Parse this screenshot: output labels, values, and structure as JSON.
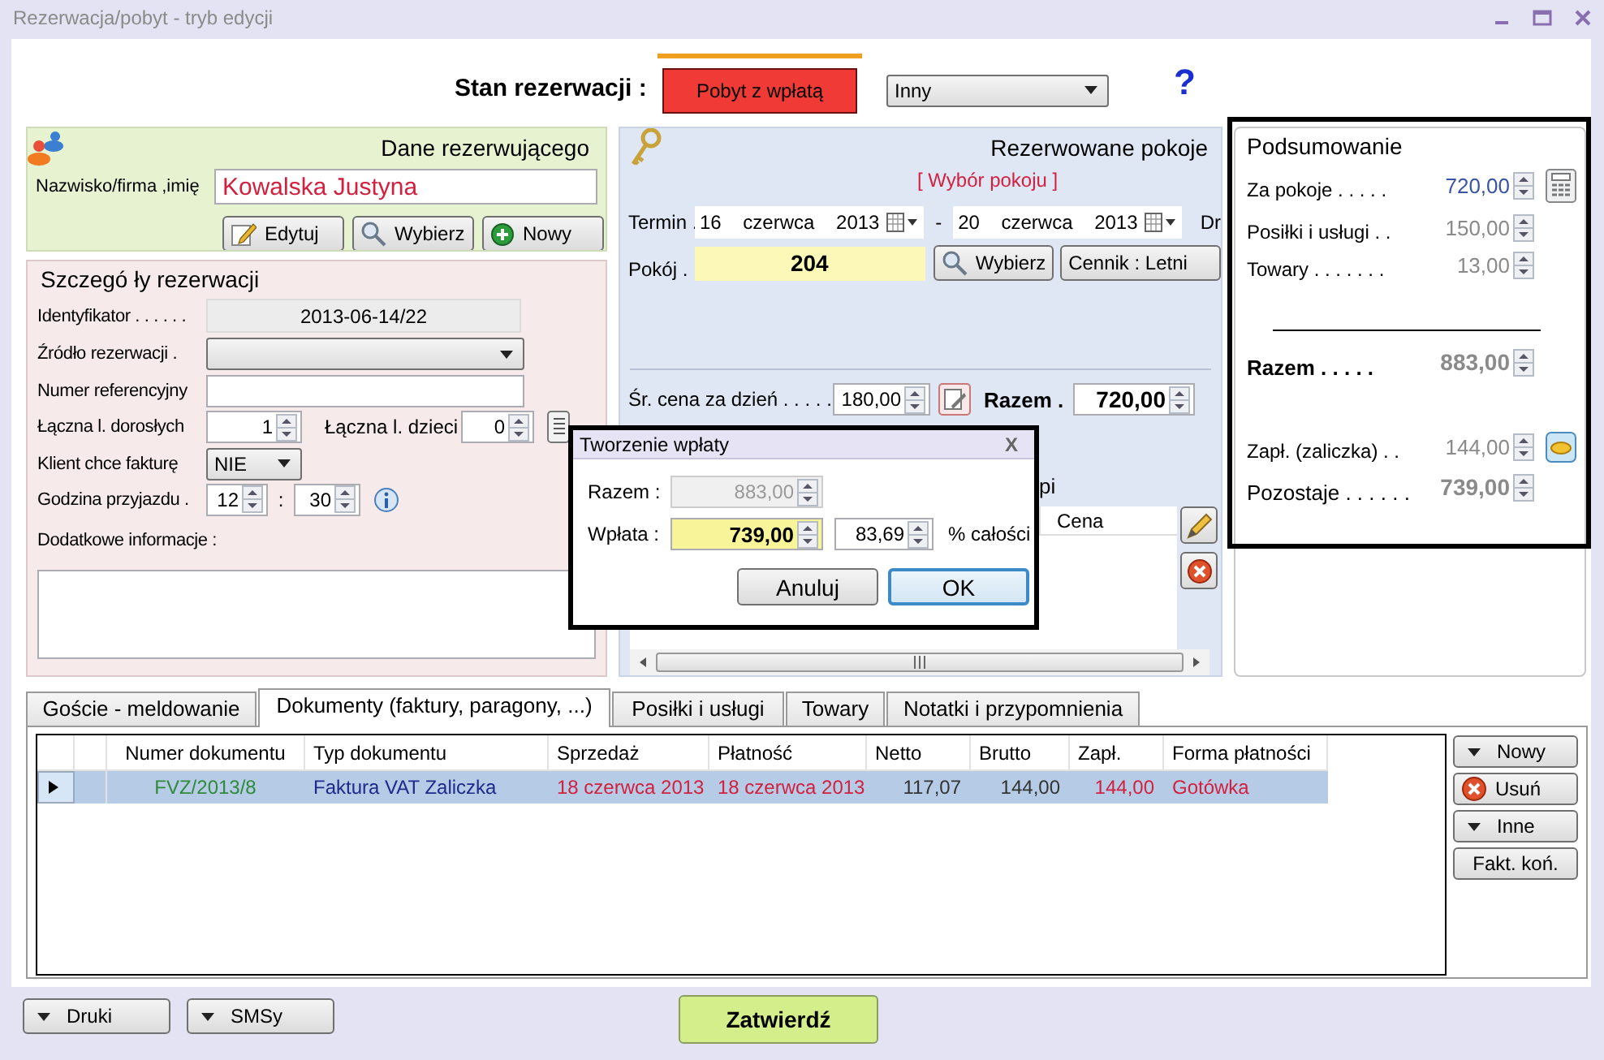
{
  "window": {
    "title": "Rezerwacja/pobyt - tryb edycji"
  },
  "status": {
    "label": "Stan rezerwacji :",
    "button": "Pobyt z wpłatą",
    "dropdown": "Inny",
    "help": "?"
  },
  "customer": {
    "title": "Dane rezerwującego",
    "name_label": "Nazwisko/firma ,imię",
    "name_value": "Kowalska Justyna",
    "buttons": [
      "Edytuj",
      "Wybierz",
      "Nowy"
    ]
  },
  "details": {
    "title": "Szczegó ły rezerwacji",
    "identifier_label": "Identyfikator . . . . . .",
    "identifier": "2013-06-14/22",
    "source_label": "Źródło rezerwacji .",
    "reference_label": "Numer referencyjny",
    "adults_label": "Łączna l. dorosłych",
    "adults": "1",
    "children_label": "Łączna l. dzieci",
    "children": "0",
    "invoice_label": "Klient chce fakturę",
    "invoice": "NIE",
    "arrival_label": "Godzina przyjazdu .",
    "arrival_hour": "12",
    "arrival_separator": ":",
    "arrival_minute": "30",
    "notes_label": "Dodatkowe informacje :"
  },
  "rooms": {
    "title": "Rezerwowane pokoje",
    "pick_link": "[ Wybór pokoju ]",
    "term_label": "Termin .",
    "date_from": "16 czerwca 2013",
    "dash": "-",
    "date_to": "20 czerwca 2013",
    "cut_label": "Dr",
    "room_label": "Pokój .",
    "room": "204",
    "pick_button": "Wybierz",
    "pricelist_button": "Cennik : Letni",
    "avg_label": "Śr. cena za dzień . . . . .",
    "avg": "180,00",
    "total_label": "Razem .",
    "total": "720,00",
    "cut_text": "pi",
    "list_column": "Cena"
  },
  "summary": {
    "title": "Podsumowanie",
    "rows": [
      {
        "label": "Za pokoje . . . . .",
        "value": "720,00",
        "kind": "item",
        "disabled": false
      },
      {
        "label": "Posiłki i usługi . .",
        "value": "150,00",
        "kind": "item",
        "disabled": true
      },
      {
        "label": "Towary . . . . . . .",
        "value": "13,00",
        "kind": "item",
        "disabled": true
      },
      {
        "label": "Razem . . . . .",
        "value": "883,00",
        "kind": "total",
        "disabled": true
      },
      {
        "label": "Zapł. (zaliczka) . .",
        "value": "144,00",
        "kind": "item",
        "disabled": true
      },
      {
        "label": "Pozostaje . . . . . .",
        "value": "739,00",
        "kind": "total",
        "disabled": true
      }
    ]
  },
  "dialog": {
    "title": "Tworzenie wpłaty",
    "close": "X",
    "total_label": "Razem :",
    "total": "883,00",
    "total_disabled": true,
    "payment_label": "Wpłata :",
    "payment": "739,00",
    "percent": "83,69",
    "percent_label": "% całości",
    "buttons": [
      {
        "label": "Anuluj",
        "default": false
      },
      {
        "label": "OK",
        "default": true
      }
    ]
  },
  "tabs": [
    {
      "label": "Goście - meldowanie",
      "selected": false
    },
    {
      "label": "Dokumenty (faktury, paragony, ...)",
      "selected": true
    },
    {
      "label": "Posiłki i usługi",
      "selected": false
    },
    {
      "label": "Towary",
      "selected": false
    },
    {
      "label": "Notatki i przypomnienia",
      "selected": false
    }
  ],
  "documents": {
    "columns": [
      "Numer dokumentu",
      "Typ dokumentu",
      "Sprzedaż",
      "Płatność",
      "Netto",
      "Brutto",
      "Zapł.",
      "Forma płatności"
    ],
    "rows": [
      {
        "selected": true,
        "cells": [
          {
            "text": "FVZ/2013/8",
            "color": "#2f8a3a"
          },
          {
            "text": "Faktura VAT Zaliczka",
            "color": "#1c2a8c"
          },
          {
            "text": "18 czerwca 2013",
            "color": "#d3203f"
          },
          {
            "text": "18 czerwca 2013",
            "color": "#d3203f"
          },
          {
            "text": "117,07",
            "color": "#333333"
          },
          {
            "text": "144,00",
            "color": "#333333"
          },
          {
            "text": "144,00",
            "color": "#d3203f"
          },
          {
            "text": "Gotówka",
            "color": "#d3203f"
          }
        ]
      }
    ]
  },
  "side_buttons": [
    {
      "label": "Nowy",
      "kind": "dropdown"
    },
    {
      "label": "Usuń",
      "kind": "delete"
    },
    {
      "label": "Inne",
      "kind": "dropdown"
    },
    {
      "label": "Fakt. koń.",
      "kind": "plain"
    }
  ],
  "bottom_buttons": [
    {
      "label": "Druki",
      "kind": "dropdown"
    },
    {
      "label": "SMSy",
      "kind": "dropdown"
    },
    {
      "label": "Zatwierdź",
      "kind": "confirm"
    }
  ]
}
